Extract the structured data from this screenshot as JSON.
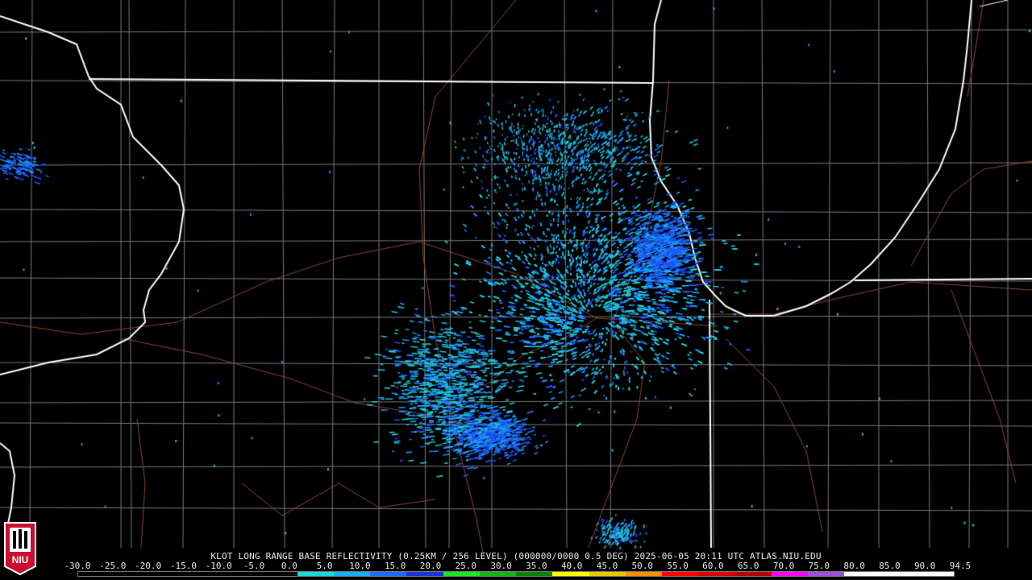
{
  "product_caption": "KLOT LONG RANGE BASE REFLECTIVITY (0.25KM / 256 LEVEL) (000000/0000 0.5 DEG) 2025-06-05 20:11 UTC  ATLAS.NIU.EDU",
  "logo_text": "NIU",
  "colors": {
    "background": "#000000",
    "state_border": "#ffffff",
    "county_line": "#7a7a7a",
    "highway": "#8a4a2a",
    "echo_light": "#20c8d8",
    "echo_mid": "#1a90ff",
    "echo_dense": "#1e50ff"
  },
  "scale": {
    "labels": [
      "-30.0",
      "-25.0",
      "-20.0",
      "-15.0",
      "-10.0",
      "-5.0",
      "0.0",
      "5.0",
      "10.0",
      "15.0",
      "20.0",
      "25.0",
      "30.0",
      "35.0",
      "40.0",
      "45.0",
      "50.0",
      "55.0",
      "60.0",
      "65.0",
      "70.0",
      "75.0",
      "80.0",
      "85.0",
      "90.0",
      "94.5"
    ],
    "colors": [
      "#000000",
      "#000000",
      "#000000",
      "#000000",
      "#000000",
      "#000000",
      "#1ad8d8",
      "#16b0f0",
      "#1e6cff",
      "#1a36d8",
      "#1ee61e",
      "#14b414",
      "#0a820a",
      "#ffff00",
      "#e8c800",
      "#ff9000",
      "#ff0000",
      "#d80000",
      "#b40000",
      "#ff00ff",
      "#9a50d8",
      "#ffffff",
      "#ffffff",
      "#ffffff"
    ]
  }
}
